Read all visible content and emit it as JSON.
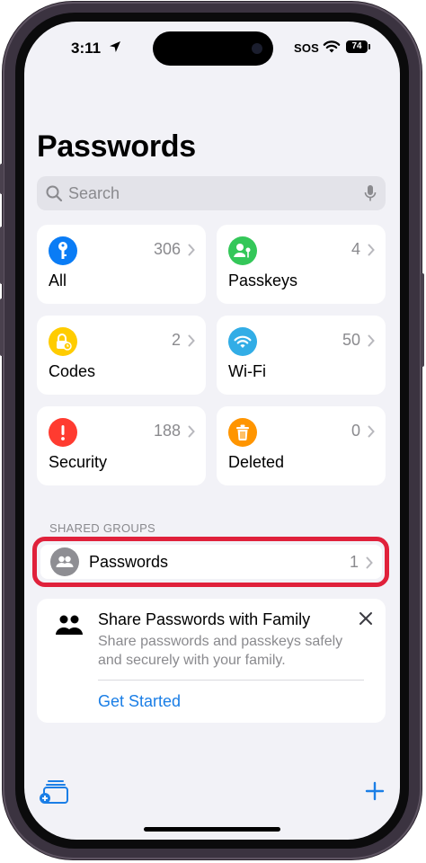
{
  "status_bar": {
    "time": "3:11",
    "sos": "SOS",
    "battery": "74"
  },
  "page": {
    "title": "Passwords"
  },
  "search": {
    "placeholder": "Search"
  },
  "categories": [
    {
      "label": "All",
      "count": "306",
      "icon": "key-icon",
      "color": "#0a7cf5"
    },
    {
      "label": "Passkeys",
      "count": "4",
      "icon": "person-key-icon",
      "color": "#34c759"
    },
    {
      "label": "Codes",
      "count": "2",
      "icon": "lock-clock-icon",
      "color": "#ffcc00"
    },
    {
      "label": "Wi-Fi",
      "count": "50",
      "icon": "wifi-icon",
      "color": "#32ade6"
    },
    {
      "label": "Security",
      "count": "188",
      "icon": "exclamation-icon",
      "color": "#ff3b30"
    },
    {
      "label": "Deleted",
      "count": "0",
      "icon": "trash-icon",
      "color": "#ff9500"
    }
  ],
  "shared_groups": {
    "header": "SHARED GROUPS",
    "items": [
      {
        "label": "Passwords",
        "count": "1"
      }
    ]
  },
  "promo": {
    "title": "Share Passwords with Family",
    "description": "Share passwords and passkeys safely and securely with your family.",
    "action": "Get Started"
  },
  "colors": {
    "accent": "#1a7ee6",
    "highlight": "#e0213b",
    "background": "#f2f2f7"
  }
}
